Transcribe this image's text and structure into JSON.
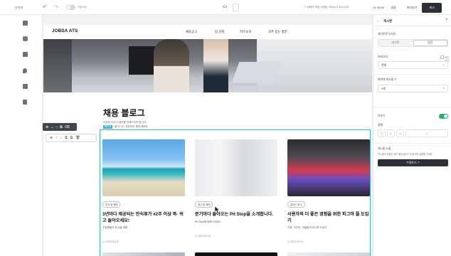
{
  "topbar": {
    "back_label": "나가기",
    "toggle_label": "자동저장",
    "saved_info": "↗ 상태가 꺼짐·수정된, 2023-07-24 12:01",
    "history_label": "01:03:08",
    "settings_label": "설정",
    "preview_label": "미리보기",
    "publish_label": "게시"
  },
  "sidebar": {
    "icons": [
      "page-icon",
      "layout-icon",
      "section-icon",
      "theme-icon",
      "component-icon",
      "file-icon"
    ]
  },
  "page": {
    "logo": "JOBDA ATS",
    "nav": [
      "채용공고",
      "팀 문화",
      "직무소개",
      "자주 묻는 질문"
    ],
    "blog_title": "채용 블로그",
    "blog_sub1": "다양한 이야기 정보를 전해드리려 합니다.",
    "blog_sub2": "을 만나는 과정부터 함께 해봐요.",
    "selection_tag": "텍스트",
    "cards": [
      {
        "badge": "회사 및 혜택",
        "title": "3년마다 제공되는 안식휴가 #2주 이상 푹- 쉬고 돌아오세요!",
        "desc": "구성원들의 휴식을 위해",
        "date": "◷ 2023.03.24"
      },
      {
        "badge": "회사 및 혜택",
        "title": "분기마다 돌아오는 Pit Stop을 소개합니다.",
        "desc": "Pit Stop에 대해 아세요?",
        "date": "◷ 2023.03.24"
      },
      {
        "badge": "일하는 방식",
        "title": "사용자의 더 좋은 경험을 위한 피그마 플 도입기",
        "desc": "기획, 디자인, 개발팀의 피그마 도입기",
        "date": "◷ 2023.03.24"
      }
    ]
  },
  "floating_toolbar": {
    "primary": [
      "⊕",
      "⌄",
      "–",
      "⧉",
      "⌫"
    ],
    "secondary": [
      "⊕",
      "↑",
      "↓",
      "⧉",
      "⧉",
      "🗑"
    ]
  },
  "rpanel": {
    "title": "게시판",
    "layout_label": "레이아웃 디자인",
    "layout_options": [
      "리스트",
      "단단"
    ],
    "category_label": "카테고리",
    "category_value": "전체",
    "show_all_label": "모두보기",
    "count_label": "화면에 게시될 수",
    "count_value": "9개",
    "more_label": "더보기",
    "align_label": "정렬",
    "align_options": [
      "▯",
      "▯",
      "▯",
      "▯"
    ],
    "align_value": "⌄",
    "url_label": "게시물 노출",
    "help": "게시물이 변경된 경우 해당 글쓰기의 링크를 설정해 주세요.",
    "button": "수정하기 ↗"
  }
}
